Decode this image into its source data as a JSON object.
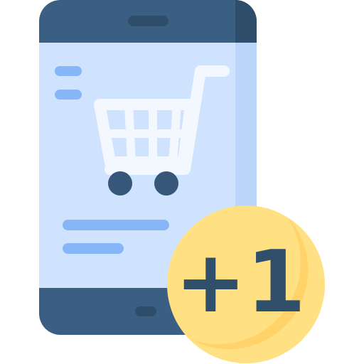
{
  "illustration": {
    "badge": {
      "text": "+1"
    },
    "icons": {
      "phone": "smartphone-icon",
      "cart": "shopping-cart-icon",
      "badge": "plus-one-badge-icon"
    },
    "colors": {
      "phone_frame": "#3a5f82",
      "phone_frame_shade": "#2e4d6a",
      "screen": "#cfe3ff",
      "screen_shade": "#bcd6fb",
      "text_lines": "#86b6f8",
      "cart": "#f3f8ff",
      "wheels": "#36577a",
      "badge": "#ffe082",
      "badge_shade": "#ffd166",
      "badge_text": "#2f4f6b"
    }
  }
}
